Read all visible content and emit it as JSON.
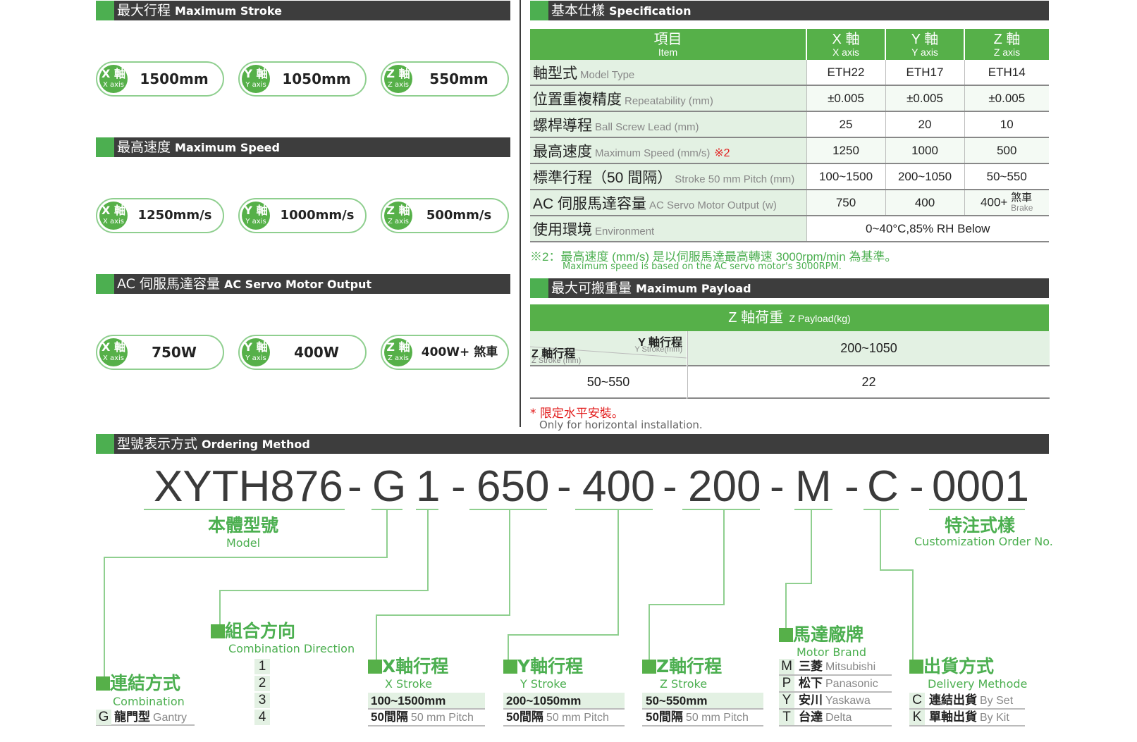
{
  "stroke": {
    "title_zh": "最大行程",
    "title_en": "Maximum Stroke",
    "pills": [
      {
        "axis": "X 軸",
        "axis_en": "X axis",
        "value": "1500mm"
      },
      {
        "axis": "Y 軸",
        "axis_en": "Y axis",
        "value": "1050mm"
      },
      {
        "axis": "Z 軸",
        "axis_en": "Z axis",
        "value": "550mm"
      }
    ]
  },
  "speed": {
    "title_zh": "最高速度",
    "title_en": "Maximum Speed",
    "pills": [
      {
        "axis": "X 軸",
        "axis_en": "X axis",
        "value": "1250mm/s"
      },
      {
        "axis": "Y 軸",
        "axis_en": "Y axis",
        "value": "1000mm/s"
      },
      {
        "axis": "Z 軸",
        "axis_en": "Z axis",
        "value": "500mm/s"
      }
    ]
  },
  "motor": {
    "title_zh": "AC 伺服馬達容量",
    "title_en": "AC Servo Motor Output",
    "pills": [
      {
        "axis": "X 軸",
        "axis_en": "X axis",
        "value": "750W"
      },
      {
        "axis": "Y 軸",
        "axis_en": "Y axis",
        "value": "400W"
      },
      {
        "axis": "Z 軸",
        "axis_en": "Z axis",
        "value": "400W+ 煞車"
      }
    ]
  },
  "spec": {
    "title_zh": "基本仕樣",
    "title_en": "Specification",
    "header": {
      "item_zh": "項目",
      "item_en": "Item",
      "x_zh": "X 軸",
      "x_en": "X axis",
      "y_zh": "Y 軸",
      "y_en": "Y axis",
      "z_zh": "Z 軸",
      "z_en": "Z axis"
    },
    "rows": [
      {
        "zh": "軸型式",
        "en": "Model Type",
        "mark": "",
        "x": "ETH22",
        "y": "ETH17",
        "z": "ETH14"
      },
      {
        "zh": "位置重複精度",
        "en": "Repeatability (mm)",
        "mark": "",
        "x": "±0.005",
        "y": "±0.005",
        "z": "±0.005"
      },
      {
        "zh": "螺桿導程",
        "en": "Ball Screw Lead (mm)",
        "mark": "",
        "x": "25",
        "y": "20",
        "z": "10"
      },
      {
        "zh": "最高速度",
        "en": "Maximum Speed (mm/s)",
        "mark": "※2",
        "x": "1250",
        "y": "1000",
        "z": "500"
      },
      {
        "zh": "標準行程（50 間隔）",
        "en": "Stroke 50 mm Pitch (mm)",
        "mark": "",
        "x": "100~1500",
        "y": "200~1050",
        "z": "50~550"
      },
      {
        "zh": "AC 伺服馬達容量",
        "en": "AC Servo Motor Output (w)",
        "mark": "",
        "x": "750",
        "y": "400",
        "z": "400+"
      }
    ],
    "brake_zh": "煞車",
    "brake_en": "Brake",
    "env": {
      "zh": "使用環境",
      "en": "Environment",
      "value": "0~40°C,85% RH Below"
    },
    "note_zh": "※2：最高速度 (mm/s) 是以伺服馬達最高轉速 3000rpm/min 為基準。",
    "note_en": "Maximum speed is based on the AC servo motor's 3000RPM."
  },
  "payload": {
    "title_zh": "最大可搬重量",
    "title_en": "Maximum Payload",
    "header_zh": "Z 軸荷重",
    "header_en": "Z Payload(kg)",
    "y_zh": "Y 軸行程",
    "y_en": "Y Stroke(mm)",
    "z_zh": "Z 軸行程",
    "z_en": "Z Stroke (mm)",
    "y_range": "200~1050",
    "z_range": "50~550",
    "value": "22",
    "note_zh": "* 限定水平安裝。",
    "note_en": "Only for horizontal installation."
  },
  "ordering": {
    "title_zh": "型號表示方式",
    "title_en": "Ordering Method",
    "code_parts": [
      "XYTH876",
      "-",
      "G",
      "1",
      "-",
      "650",
      "-",
      "400",
      "-",
      "200",
      "-",
      "M",
      "-",
      "C",
      "-",
      "0001"
    ],
    "model_zh": "本體型號",
    "model_en": "Model",
    "custom_zh": "特注式樣",
    "custom_en": "Customization Order No.",
    "combination": {
      "zh": "連結方式",
      "en": "Combination",
      "key": "G",
      "opt_zh": "龍門型",
      "opt_en": "Gantry"
    },
    "direction": {
      "zh": "組合方向",
      "en": "Combination Direction",
      "options": [
        "1",
        "2",
        "3",
        "4"
      ]
    },
    "x_stroke": {
      "zh": "X軸行程",
      "en": "X Stroke",
      "range": "100~1500mm",
      "pitch_zh": "50間隔",
      "pitch_en": "50 mm Pitch"
    },
    "y_stroke": {
      "zh": "Y軸行程",
      "en": "Y Stroke",
      "range": "200~1050mm",
      "pitch_zh": "50間隔",
      "pitch_en": "50 mm Pitch"
    },
    "z_stroke": {
      "zh": "Z軸行程",
      "en": "Z Stroke",
      "range": "50~550mm",
      "pitch_zh": "50間隔",
      "pitch_en": "50 mm Pitch"
    },
    "brand": {
      "zh": "馬達廠牌",
      "en": "Motor Brand",
      "options": [
        {
          "key": "M",
          "zh": "三菱",
          "en": "Mitsubishi"
        },
        {
          "key": "P",
          "zh": "松下",
          "en": "Panasonic"
        },
        {
          "key": "Y",
          "zh": "安川",
          "en": "Yaskawa"
        },
        {
          "key": "T",
          "zh": "台達",
          "en": "Delta"
        }
      ]
    },
    "delivery": {
      "zh": "出貨方式",
      "en": "Delivery Methode",
      "options": [
        {
          "key": "C",
          "zh": "連結出貨",
          "en": "By Set"
        },
        {
          "key": "K",
          "zh": "單軸出貨",
          "en": "By Kit"
        }
      ]
    }
  },
  "colors": {
    "accent": "#56b049",
    "header_bar": "#3d3d3d",
    "row_bg": "#e3f1e3",
    "note_red": "#e21b1b"
  }
}
